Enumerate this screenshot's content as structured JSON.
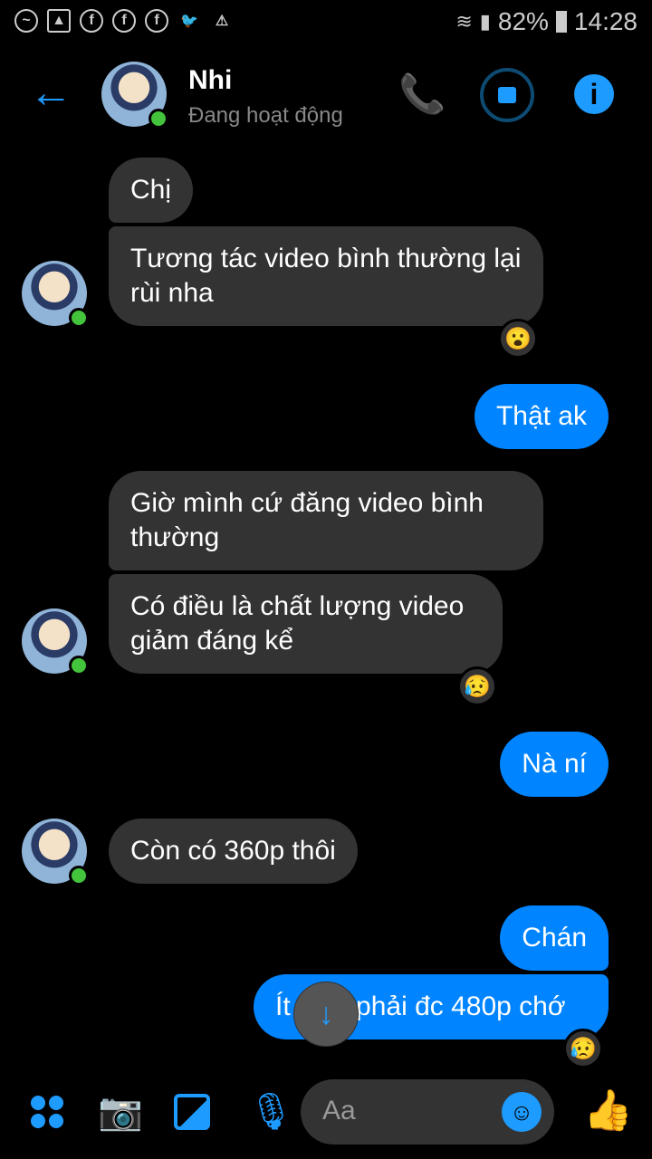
{
  "status_bar": {
    "battery": "82%",
    "time": "14:28",
    "notification_icons": [
      "messenger-icon",
      "gallery-icon",
      "facebook-icon",
      "facebook-icon",
      "facebook-icon",
      "twitter-icon",
      "warning-icon"
    ]
  },
  "header": {
    "name": "Nhi",
    "status": "Đang hoạt động"
  },
  "messages": [
    {
      "from": "them",
      "text": "Chị"
    },
    {
      "from": "them",
      "text": "Tương tác video bình thường lại rùi nha",
      "reaction": "😮"
    },
    {
      "from": "me",
      "text": "Thật ak"
    },
    {
      "from": "them",
      "text": "Giờ mình cứ đăng video bình thường"
    },
    {
      "from": "them",
      "text": "Có điều là chất lượng video giảm đáng kể",
      "reaction": "😥"
    },
    {
      "from": "me",
      "text": "Nà ní"
    },
    {
      "from": "them",
      "text": "Còn có 360p thôi"
    },
    {
      "from": "me",
      "text": "Chán"
    },
    {
      "from": "me",
      "text_start": "Ít",
      "text_end": "phải đc 480p chớ",
      "reaction": "😥"
    }
  ],
  "composer": {
    "placeholder": "Aa"
  },
  "colors": {
    "accent": "#0084ff",
    "icon": "#1e9bff",
    "incoming": "#333334"
  }
}
